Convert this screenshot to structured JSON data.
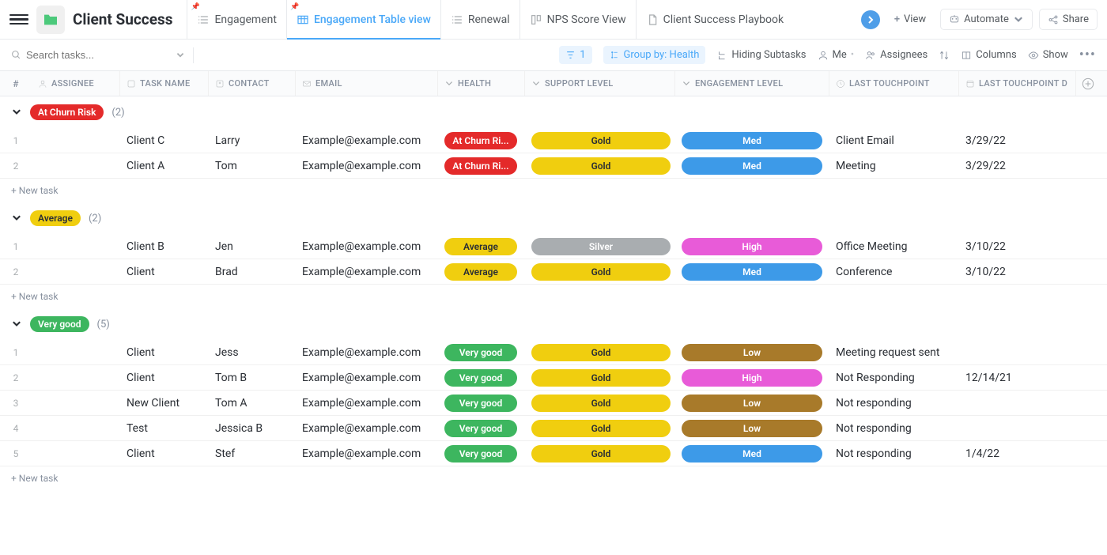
{
  "header": {
    "title": "Client Success",
    "tabs": [
      {
        "label": "Engagement",
        "icon": "list",
        "active": false,
        "pinned": true
      },
      {
        "label": "Engagement Table view",
        "icon": "table",
        "active": true,
        "pinned": true
      },
      {
        "label": "Renewal",
        "icon": "list",
        "active": false,
        "pinned": false
      },
      {
        "label": "NPS Score View",
        "icon": "board",
        "active": false,
        "pinned": false
      },
      {
        "label": "Client Success Playbook",
        "icon": "doc",
        "active": false,
        "pinned": false
      }
    ],
    "addView": "View",
    "automate": "Automate",
    "share": "Share"
  },
  "toolbar": {
    "searchPlaceholder": "Search tasks...",
    "filterCount": "1",
    "groupBy": "Group by: Health",
    "hiding": "Hiding Subtasks",
    "me": "Me",
    "assignees": "Assignees",
    "columns": "Columns",
    "show": "Show"
  },
  "columns": {
    "num": "#",
    "assignee": "ASSIGNEE",
    "taskName": "TASK NAME",
    "contact": "CONTACT",
    "email": "EMAIL",
    "health": "HEALTH",
    "support": "SUPPORT LEVEL",
    "engagement": "ENGAGEMENT LEVEL",
    "lastTouchpoint": "LAST TOUCHPOINT",
    "lastDate": "LAST TOUCHPOINT D"
  },
  "pillColors": {
    "At Churn Risk": "bg-red",
    "Average": "bg-yellow",
    "Very good": "bg-green",
    "Gold": "bg-yellow",
    "Silver": "bg-silver",
    "Med": "bg-blue",
    "High": "bg-pink",
    "Low": "bg-brown"
  },
  "groups": [
    {
      "name": "At Churn Risk",
      "count": "(2)",
      "rows": [
        {
          "num": "1",
          "task": "Client C",
          "contact": "Larry",
          "email": "Example@example.com",
          "health": "At Churn Ri...",
          "support": "Gold",
          "engagement": "Med",
          "touch": "Client Email",
          "date": "3/29/22"
        },
        {
          "num": "2",
          "task": "Client A",
          "contact": "Tom",
          "email": "Example@example.com",
          "health": "At Churn Ri...",
          "support": "Gold",
          "engagement": "Med",
          "touch": "Meeting",
          "date": "3/29/22"
        }
      ]
    },
    {
      "name": "Average",
      "count": "(2)",
      "rows": [
        {
          "num": "1",
          "task": "Client B",
          "contact": "Jen",
          "email": "Example@example.com",
          "health": "Average",
          "support": "Silver",
          "engagement": "High",
          "touch": "Office Meeting",
          "date": "3/10/22"
        },
        {
          "num": "2",
          "task": "Client",
          "contact": "Brad",
          "email": "Example@example.com",
          "health": "Average",
          "support": "Gold",
          "engagement": "Med",
          "touch": "Conference",
          "date": "3/10/22"
        }
      ]
    },
    {
      "name": "Very good",
      "count": "(5)",
      "rows": [
        {
          "num": "1",
          "task": "Client",
          "contact": "Jess",
          "email": "Example@example.com",
          "health": "Very good",
          "support": "Gold",
          "engagement": "Low",
          "touch": "Meeting request sent",
          "date": ""
        },
        {
          "num": "2",
          "task": "Client",
          "contact": "Tom B",
          "email": "Example@example.com",
          "health": "Very good",
          "support": "Gold",
          "engagement": "High",
          "touch": "Not Responding",
          "date": "12/14/21"
        },
        {
          "num": "3",
          "task": "New Client",
          "contact": "Tom A",
          "email": "Example@example.com",
          "health": "Very good",
          "support": "Gold",
          "engagement": "Low",
          "touch": "Not responding",
          "date": ""
        },
        {
          "num": "4",
          "task": "Test",
          "contact": "Jessica B",
          "email": "Example@example.com",
          "health": "Very good",
          "support": "Gold",
          "engagement": "Low",
          "touch": "Not responding",
          "date": ""
        },
        {
          "num": "5",
          "task": "Client",
          "contact": "Stef",
          "email": "Example@example.com",
          "health": "Very good",
          "support": "Gold",
          "engagement": "Med",
          "touch": "Not responding",
          "date": "1/4/22"
        }
      ]
    }
  ],
  "newTask": "+ New task"
}
